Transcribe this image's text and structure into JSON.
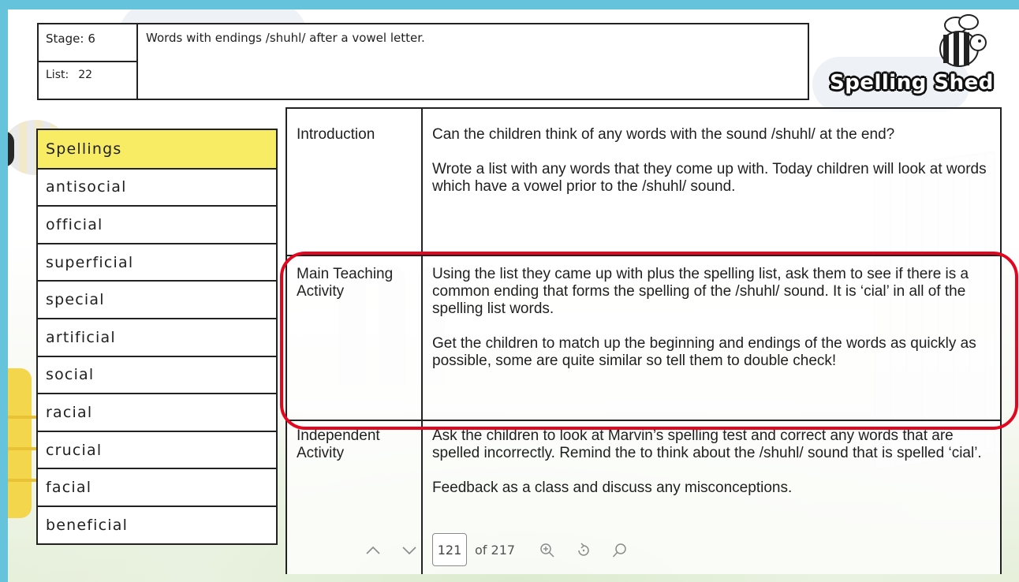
{
  "header": {
    "stage_label": "Stage:",
    "stage_value": "6",
    "list_label": "List:",
    "list_value": "22",
    "title": "Words with endings /shuhl/ after a vowel letter."
  },
  "logo": {
    "text": "Spelling Shed"
  },
  "spellings": {
    "heading": "Spellings",
    "words": [
      "antisocial",
      "official",
      "superficial",
      "special",
      "artificial",
      "social",
      "racial",
      "crucial",
      "facial",
      "beneficial"
    ]
  },
  "lesson": [
    {
      "label": "Introduction",
      "paragraphs": [
        "Can the children think of any words with the sound /shuhl/ at the end?",
        "Wrote a list with any words that they come up with. Today children will look at words which have a vowel prior to the /shuhl/ sound."
      ]
    },
    {
      "label": "Main Teaching Activity",
      "paragraphs": [
        "Using the list they came up with plus the spelling list, ask them to see if there is a common ending that forms the spelling of the /shuhl/ sound. It is ‘cial’ in all of the spelling list words.",
        "Get the children to match up the beginning and endings of the words as quickly as possible, some are quite similar so tell them to double check!"
      ]
    },
    {
      "label": "Independent Activity",
      "paragraphs": [
        "Ask the children to look at Marvin’s spelling test and correct any words that are spelled incorrectly. Remind the to think about the /shuhl/ sound that is spelled ‘cial’.",
        "Feedback as a class and discuss any misconceptions."
      ]
    }
  ],
  "toolbar": {
    "page": "121",
    "of_total": "of 217",
    "icons": [
      "chevron-up-icon",
      "chevron-down-icon",
      "zoom-in-icon",
      "rotate-icon",
      "search-icon"
    ]
  },
  "colors": {
    "highlight": "#e3061f",
    "spellings_header": "#f7ec63",
    "frame": "#66c3dc"
  }
}
